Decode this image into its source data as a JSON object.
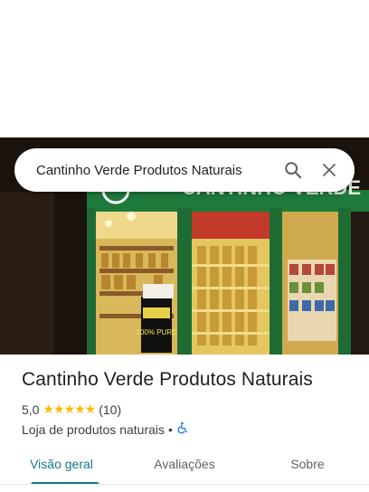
{
  "search": {
    "query": "Cantinho Verde Produtos Naturais"
  },
  "store_sign": {
    "text": "CANTINHO VERDE"
  },
  "photo_poster": {
    "text": "100% PURE"
  },
  "place": {
    "name": "Cantinho Verde Produtos Naturais",
    "rating": "5,0",
    "stars": "★★★★★",
    "review_count": "(10)",
    "category": "Loja de produtos naturais",
    "separator": "•",
    "accessibility_icon": "wheelchair-icon"
  },
  "tabs": [
    {
      "label": "Visão geral",
      "active": true
    },
    {
      "label": "Avaliações",
      "active": false
    },
    {
      "label": "Sobre",
      "active": false
    }
  ],
  "colors": {
    "accent": "#137b88",
    "star": "#fbbc04",
    "accessibility": "#1a73e8",
    "sign_green": "#1e7a3a"
  },
  "icons": {
    "search": "search-icon",
    "close": "close-icon"
  }
}
